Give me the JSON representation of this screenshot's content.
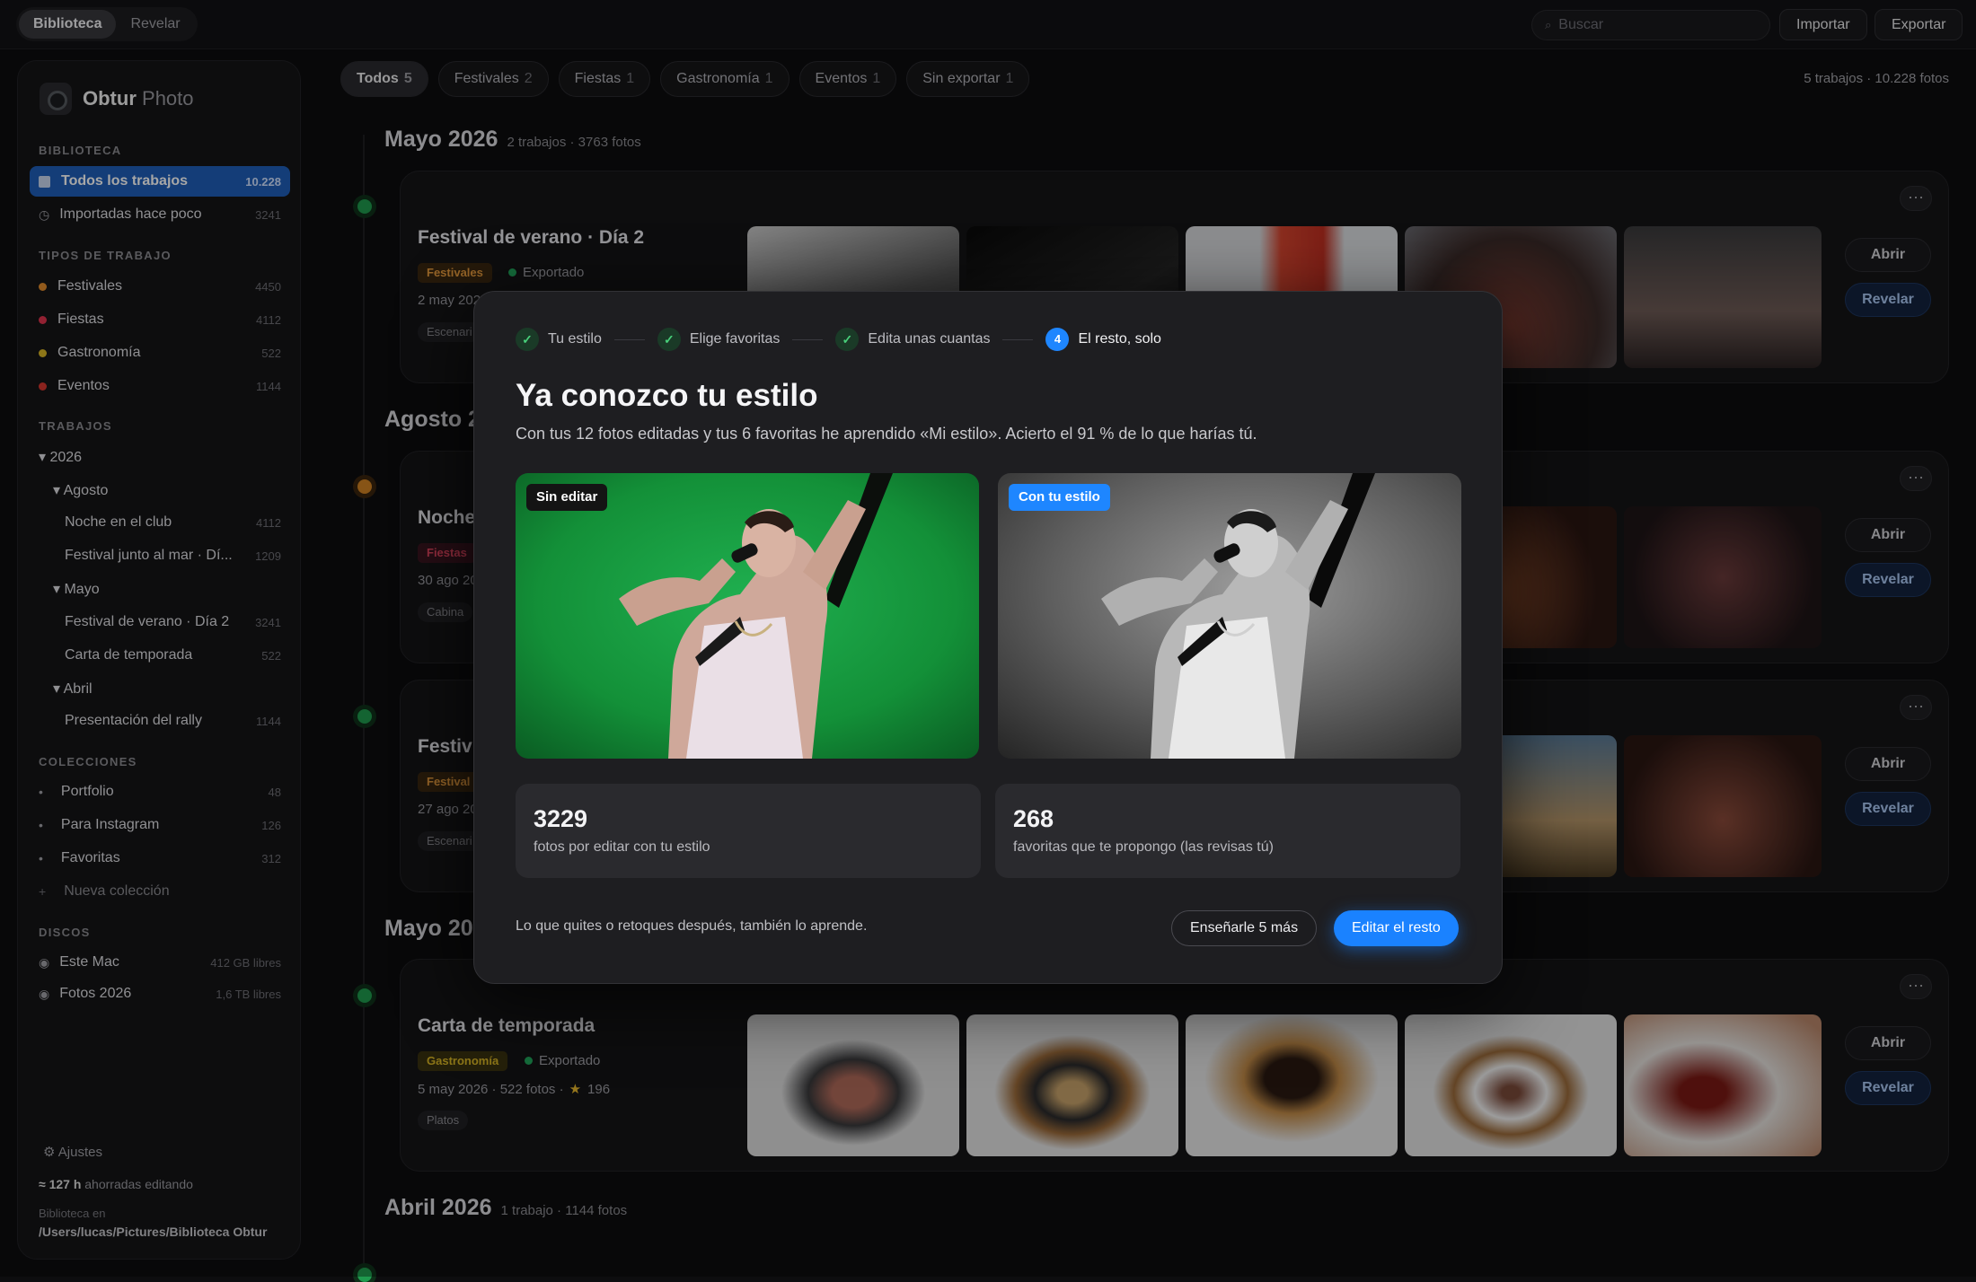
{
  "topbar": {
    "tab_library": "Biblioteca",
    "tab_develop": "Revelar",
    "search_placeholder": "Buscar",
    "import": "Importar",
    "export": "Exportar"
  },
  "app": {
    "name_bold": "Obtur",
    "name_light": "Photo"
  },
  "sidebar": {
    "library_header": "BIBLIOTECA",
    "library": [
      {
        "label": "Todos los trabajos",
        "count": "10.228"
      },
      {
        "label": "Importadas hace poco",
        "count": "3241"
      }
    ],
    "types_header": "TIPOS DE TRABAJO",
    "types": [
      {
        "label": "Festivales",
        "count": "4450",
        "color": "#e08a2c"
      },
      {
        "label": "Fiestas",
        "count": "4112",
        "color": "#e0344e"
      },
      {
        "label": "Gastronomía",
        "count": "522",
        "color": "#d9b526"
      },
      {
        "label": "Eventos",
        "count": "1144",
        "color": "#d6362e"
      }
    ],
    "jobs_header": "TRABAJOS",
    "tree": {
      "year": "▾ 2026",
      "m1": "▾ Agosto",
      "j1": "Noche en el club",
      "j1c": "4112",
      "j2": "Festival junto al mar · Dí...",
      "j2c": "1209",
      "m2": "▾ Mayo",
      "j3": "Festival de verano · Día 2",
      "j3c": "3241",
      "j4": "Carta de temporada",
      "j4c": "522",
      "m3": "▾ Abril",
      "j5": "Presentación del rally",
      "j5c": "1144"
    },
    "collections_header": "COLECCIONES",
    "collections": [
      {
        "label": "Portfolio",
        "count": "48"
      },
      {
        "label": "Para Instagram",
        "count": "126"
      },
      {
        "label": "Favoritas",
        "count": "312"
      }
    ],
    "new_collection": "Nueva colección",
    "disks_header": "DISCOS",
    "disks": [
      {
        "label": "Este Mac",
        "count": "412 GB libres"
      },
      {
        "label": "Fotos 2026",
        "count": "1,6 TB libres"
      }
    ],
    "settings": "Ajustes",
    "saved_value": "≈ 127 h",
    "saved_text": "ahorradas editando",
    "library_at": "Biblioteca en",
    "library_path": "/Users/lucas/Pictures/Biblioteca Obtur"
  },
  "filters": [
    {
      "label": "Todos",
      "n": "5"
    },
    {
      "label": "Festivales",
      "n": "2"
    },
    {
      "label": "Fiestas",
      "n": "1"
    },
    {
      "label": "Gastronomía",
      "n": "1"
    },
    {
      "label": "Eventos",
      "n": "1"
    },
    {
      "label": "Sin exportar",
      "n": "1"
    }
  ],
  "summary": "5 trabajos · 10.228 fotos",
  "months": [
    {
      "title": "Mayo 2026",
      "sub": "2 trabajos · 3763 fotos"
    },
    {
      "title": "Agosto 2"
    },
    {
      "title": "Mayo 20"
    },
    {
      "title": "Abril 2026",
      "sub": "1 trabajo · 1144 fotos"
    }
  ],
  "cards": {
    "c1": {
      "title": "Festival de verano · Día 2",
      "tag": "Festivales",
      "status": "Exportado",
      "meta": "2 may 202",
      "loc": "Escenari"
    },
    "c2": {
      "title": "Noche",
      "tag": "Fiestas",
      "meta": "30 ago 20",
      "loc": "Cabina"
    },
    "c3": {
      "title": "Festiv",
      "tag": "Festival",
      "meta": "27 ago 20",
      "loc": "Escenari"
    },
    "c4": {
      "title": "Carta de temporada",
      "tag": "Gastronomía",
      "status": "Exportado",
      "meta": "5 may 2026 · 522 fotos ·",
      "fav": "196",
      "loc": "Platos"
    },
    "more": "···",
    "open": "Abrir",
    "develop": "Revelar"
  },
  "modal": {
    "steps": [
      {
        "mark": "✓",
        "label": "Tu estilo"
      },
      {
        "mark": "✓",
        "label": "Elige favoritas"
      },
      {
        "mark": "✓",
        "label": "Edita unas cuantas"
      },
      {
        "mark": "4",
        "label": "El resto, solo"
      }
    ],
    "title": "Ya conozco tu estilo",
    "subtitle": "Con tus 12 fotos editadas y tus 6 favoritas he aprendido «Mi estilo». Acierto el 91 % de lo que harías tú.",
    "before_label": "Sin editar",
    "after_label": "Con tu estilo",
    "stat1_num": "3229",
    "stat1_label": "fotos por editar con tu estilo",
    "stat2_num": "268",
    "stat2_label": "favoritas que te propongo (las revisas tú)",
    "note": "Lo que quites o retoques después, también lo aprende.",
    "btn_more": "Enseñarle 5 más",
    "btn_edit": "Editar el resto"
  }
}
